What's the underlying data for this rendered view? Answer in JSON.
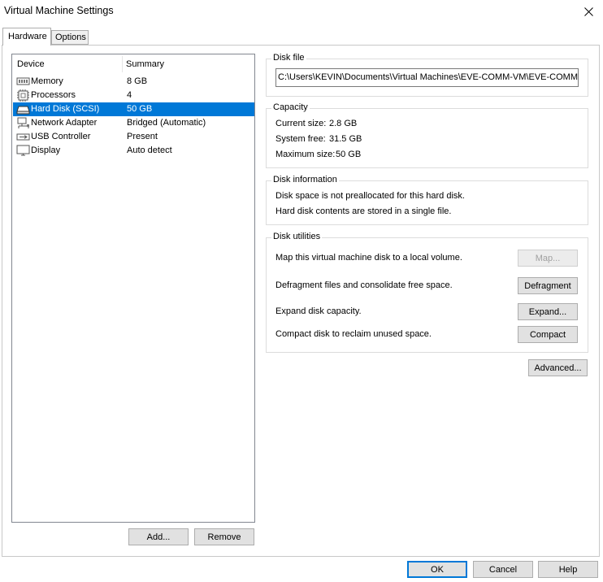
{
  "window": {
    "title": "Virtual Machine Settings"
  },
  "tabs": [
    {
      "label": "Hardware"
    },
    {
      "label": "Options"
    }
  ],
  "device_list": {
    "columns": {
      "device": "Device",
      "summary": "Summary"
    },
    "rows": [
      {
        "name": "Memory",
        "summary": "8 GB",
        "icon": "memory-icon"
      },
      {
        "name": "Processors",
        "summary": "4",
        "icon": "processor-icon"
      },
      {
        "name": "Hard Disk (SCSI)",
        "summary": "50 GB",
        "icon": "hard-disk-icon",
        "selected": true
      },
      {
        "name": "Network Adapter",
        "summary": "Bridged (Automatic)",
        "icon": "network-adapter-icon"
      },
      {
        "name": "USB Controller",
        "summary": "Present",
        "icon": "usb-controller-icon"
      },
      {
        "name": "Display",
        "summary": "Auto detect",
        "icon": "display-icon"
      }
    ],
    "add_label": "Add...",
    "remove_label": "Remove"
  },
  "disk_file": {
    "label": "Disk file",
    "path": "C:\\Users\\KEVIN\\Documents\\Virtual Machines\\EVE-COMM-VM\\EVE-COMM-VM.vmdk"
  },
  "capacity": {
    "label": "Capacity",
    "current_size_label": "Current size:",
    "current_size": "2.8 GB",
    "system_free_label": "System free:",
    "system_free": "31.5 GB",
    "maximum_size_label": "Maximum size:",
    "maximum_size": "50 GB"
  },
  "disk_information": {
    "label": "Disk information",
    "line1": "Disk space is not preallocated for this hard disk.",
    "line2": "Hard disk contents are stored in a single file."
  },
  "disk_utilities": {
    "label": "Disk utilities",
    "map_text": "Map this virtual machine disk to a local volume.",
    "map_button": "Map...",
    "defrag_text": "Defragment files and consolidate free space.",
    "defrag_button": "Defragment",
    "expand_text": "Expand disk capacity.",
    "expand_button": "Expand...",
    "compact_text": "Compact disk to reclaim unused space.",
    "compact_button": "Compact"
  },
  "advanced_button": "Advanced...",
  "footer": {
    "ok": "OK",
    "cancel": "Cancel",
    "help": "Help"
  },
  "colors": {
    "selection": "#0078d7",
    "button_face": "#e1e1e1",
    "group_border": "#dcdcdc"
  }
}
